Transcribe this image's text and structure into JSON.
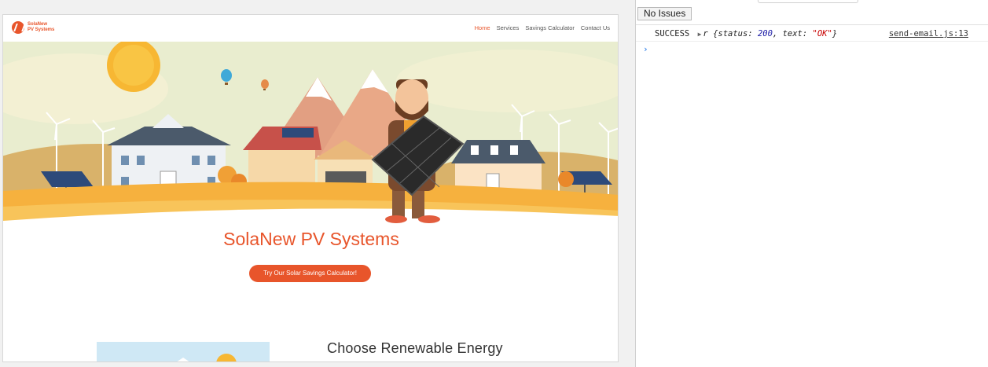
{
  "site": {
    "logo_line1": "SolaNew",
    "logo_line2": "PV Systems",
    "nav": [
      "Home",
      "Services",
      "Savings Calculator",
      "Contact Us"
    ],
    "hero_title": "SolaNew PV Systems",
    "cta_label": "Try Our Solar Savings Calculator!",
    "section_title": "Choose Renewable Energy",
    "colors": {
      "accent": "#e8552b",
      "sky": "#e7ebc9",
      "ground": "#f3a53a"
    }
  },
  "devtools": {
    "issues_button": "No Issues",
    "log": {
      "label": "SUCCESS",
      "obj_name": "r",
      "open": "{status: ",
      "status": "200",
      "mid": ", text: ",
      "text": "\"OK\"",
      "close": "}",
      "source": "send-email.js:13"
    },
    "prompt_glyph": "›"
  }
}
